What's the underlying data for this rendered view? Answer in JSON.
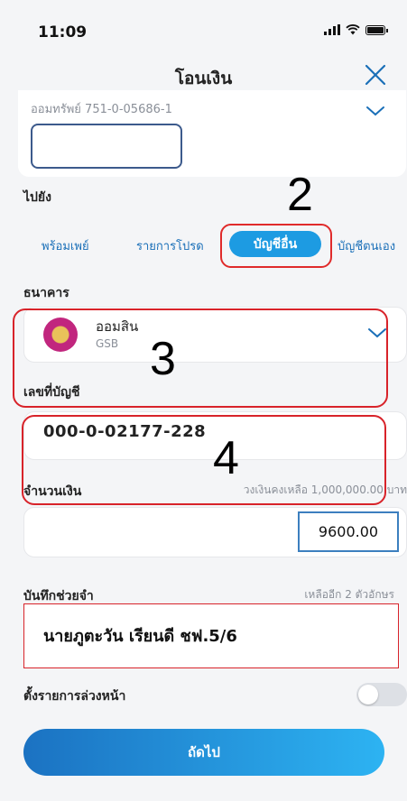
{
  "status_bar": {
    "time": "11:09"
  },
  "header": {
    "title": "โอนเงิน"
  },
  "from_account": {
    "label": "ออมทรัพย์ 751-0-05686-1"
  },
  "to": {
    "label": "ไปยัง"
  },
  "tabs": [
    {
      "label": "พร้อมเพย์"
    },
    {
      "label": "รายการโปรด"
    },
    {
      "label": "บัญชีอื่น",
      "active": true
    },
    {
      "label": "บัญชีตนเอง"
    }
  ],
  "bank": {
    "label": "ธนาคาร",
    "name": "ออมสิน",
    "code": "GSB"
  },
  "account": {
    "label": "เลขที่บัญชี",
    "value": "000-0-02177-228"
  },
  "amount": {
    "label": "จำนวนเงิน",
    "limit_text": "วงเงินคงเหลือ 1,000,000.00 บาท",
    "value": "9600.00"
  },
  "memo": {
    "label": "บันทึกช่วยจำ",
    "remaining_text": "เหลืออีก 2 ตัวอักษร",
    "value": "นายภูตะวัน เรียนดี ชฟ.5/6"
  },
  "schedule": {
    "label": "ตั้งรายการล่วงหน้า"
  },
  "next_button": {
    "label": "ถัดไป"
  },
  "annotations": [
    "2",
    "3",
    "4"
  ],
  "colors": {
    "accent": "#1d9be2",
    "highlight_red": "#d8232a",
    "dark_blue_outline": "#3c5a8c"
  }
}
